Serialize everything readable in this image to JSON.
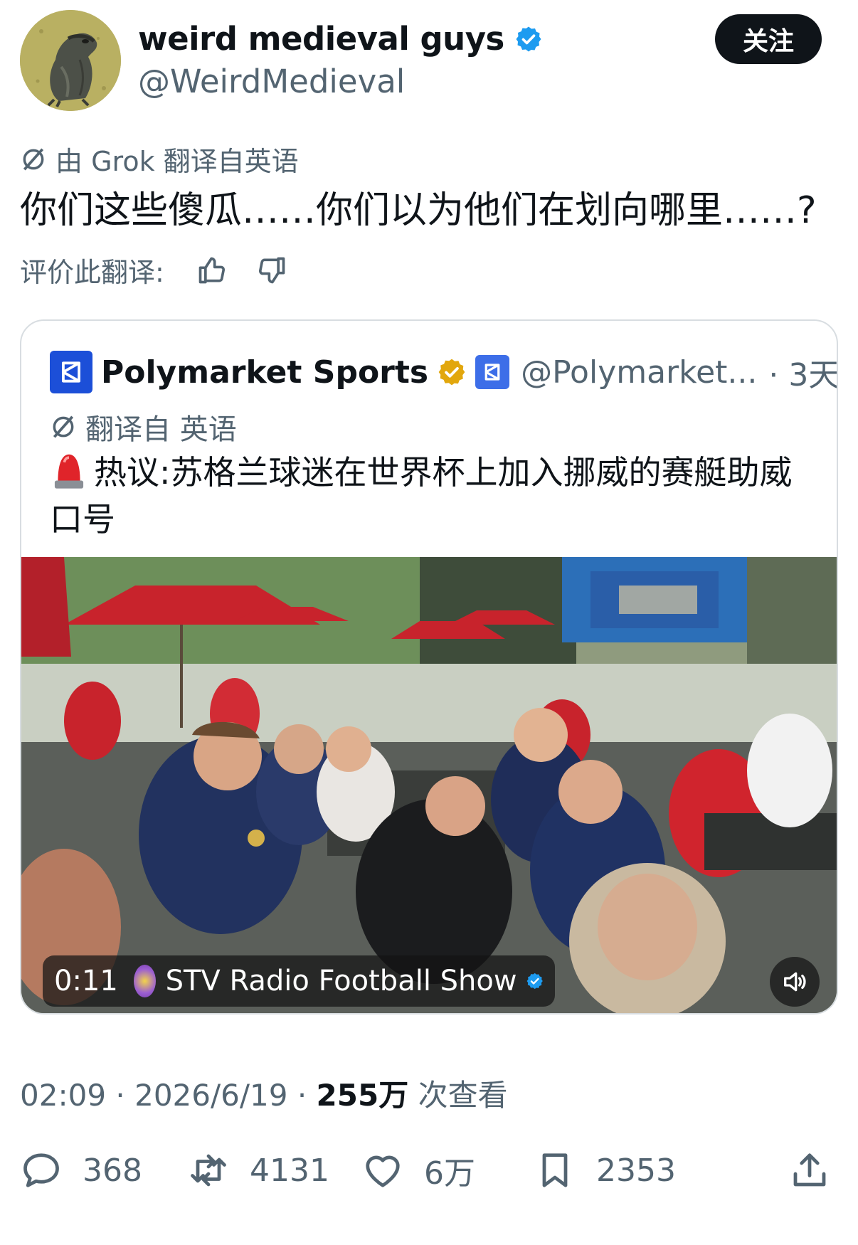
{
  "author": {
    "display_name": "weird medieval guys",
    "handle": "@WeirdMedieval",
    "avatar_icon": "frog-avatar-icon",
    "verified_color": "#1d9bf0"
  },
  "follow_button": {
    "label": "关注"
  },
  "translation": {
    "by_label": "由 Grok 翻译自英语",
    "text": "你们这些傻瓜……你们以为他们在划向哪里……?",
    "rate_label": "评价此翻译:",
    "thumbs_up_icon": "thumbs-up-icon",
    "thumbs_down_icon": "thumbs-down-icon"
  },
  "quote": {
    "name": "Polymarket Sports",
    "handle": "@Polymarket...",
    "time": "· 3天",
    "translated_label": "翻译自 英语",
    "text": "热议:苏格兰球迷在世界杯上加入挪威的赛艇助威口号",
    "verified_color": "#e2a70d",
    "video": {
      "time": "0:11",
      "source": "STV Radio Football Show",
      "mute_icon": "speaker-icon"
    }
  },
  "meta": {
    "time": "02:09",
    "date": "2026/6/19",
    "views_count": "255万",
    "views_label": "次查看"
  },
  "actions": {
    "replies": "368",
    "reposts": "4131",
    "likes": "6万",
    "bookmarks": "2353"
  }
}
